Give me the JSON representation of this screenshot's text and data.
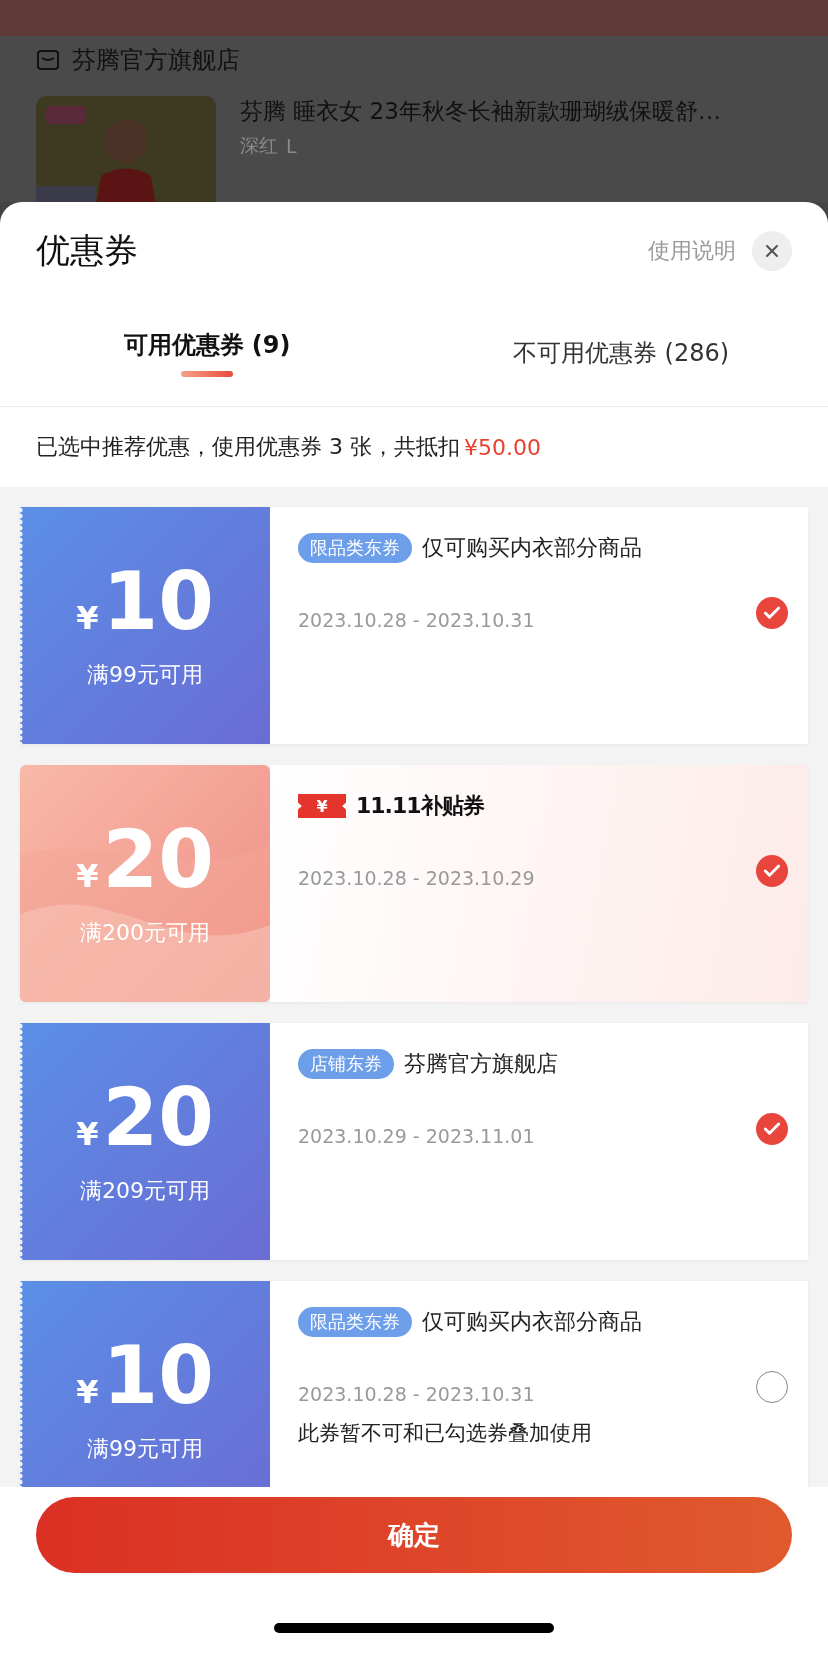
{
  "background_page": {
    "store_name": "芬腾官方旗舰店",
    "product": {
      "title": "芬腾 睡衣女 23年秋冬长袖新款珊瑚绒保暖舒…",
      "variant": "深红",
      "size": "L"
    }
  },
  "sheet": {
    "title": "优惠券",
    "help_link": "使用说明",
    "tabs": [
      {
        "label": "可用优惠券 (9)",
        "selected": true
      },
      {
        "label": "不可用优惠券 (286)",
        "selected": false
      }
    ],
    "summary": {
      "text": "已选中推荐优惠，使用优惠券 3 张，共抵扣",
      "amount": "¥50.00"
    },
    "coupons": [
      {
        "kind": "normal",
        "currency": "¥",
        "amount": "10",
        "condition": "满99元可用",
        "tag": "限品类东券",
        "description": "仅可购买内衣部分商品",
        "dates": "2023.10.28 - 2023.10.31",
        "checked": true
      },
      {
        "kind": "subsidy",
        "currency": "¥",
        "amount": "20",
        "condition": "满200元可用",
        "badge_symbol": "¥",
        "tag": "11.11补贴券",
        "dates": "2023.10.28 - 2023.10.29",
        "checked": true
      },
      {
        "kind": "normal",
        "currency": "¥",
        "amount": "20",
        "condition": "满209元可用",
        "tag": "店铺东券",
        "description": "芬腾官方旗舰店",
        "dates": "2023.10.29 - 2023.11.01",
        "checked": true
      },
      {
        "kind": "normal",
        "currency": "¥",
        "amount": "10",
        "condition": "满99元可用",
        "tag": "限品类东券",
        "description": "仅可购买内衣部分商品",
        "dates": "2023.10.28 - 2023.10.31",
        "note": "此券暂不可和已勾选券叠加使用",
        "checked": false
      }
    ],
    "confirm_button": "确定"
  }
}
